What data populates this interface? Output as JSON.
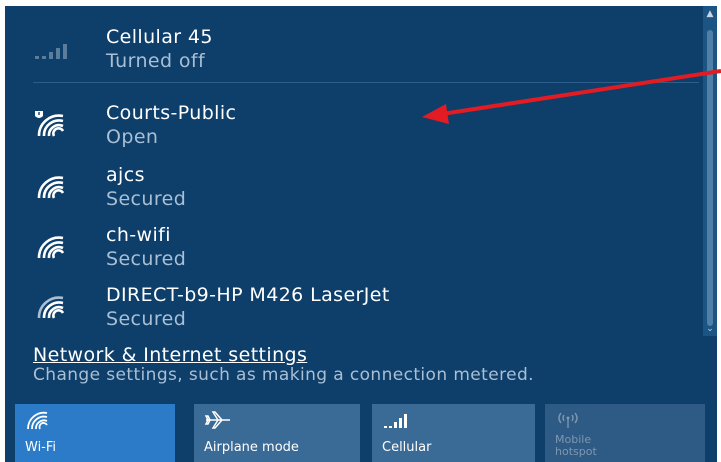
{
  "networks": [
    {
      "name": "Cellular 45",
      "status": "Turned off",
      "icon": "cellular-signal-icon"
    },
    {
      "name": "Courts-Public",
      "status": "Open",
      "icon": "wifi-open-shield-icon"
    },
    {
      "name": "ajcs",
      "status": "Secured",
      "icon": "wifi-icon"
    },
    {
      "name": "ch-wifi",
      "status": "Secured",
      "icon": "wifi-icon"
    },
    {
      "name": "DIRECT-b9-HP M426 LaserJet",
      "status": "Secured",
      "icon": "wifi-icon"
    }
  ],
  "settings": {
    "link": "Network & Internet settings",
    "description": "Change settings, such as making a connection metered."
  },
  "tiles": [
    {
      "label": "Wi-Fi",
      "active": true,
      "icon": "wifi-icon"
    },
    {
      "label": "Airplane mode",
      "active": false,
      "icon": "airplane-icon"
    },
    {
      "label": "Cellular",
      "active": false,
      "icon": "cellular-signal-icon"
    },
    {
      "label": "Mobile hotspot",
      "active": false,
      "icon": "hotspot-icon"
    }
  ],
  "colors": {
    "panel": "#0e3f6b",
    "tile_active": "#2b7bc8",
    "tile_inactive": "#3a6a96",
    "tile_disabled": "#2e5b85",
    "annotation_arrow": "#e31b23"
  }
}
